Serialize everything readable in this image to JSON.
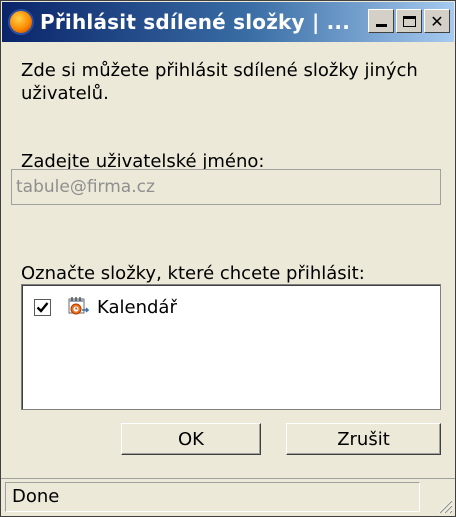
{
  "window": {
    "title": "Přihlásit sdílené složky | ..."
  },
  "dialog": {
    "intro_text": "Zde si můžete přihlásit sdílené složky jiných uživatelů.",
    "username_label": "Zadejte uživatelské jméno:",
    "username_value": "tabule@firma.cz",
    "folders_label": "Označte složky, které chcete přihlásit:",
    "folders": [
      {
        "label": "Kalendář",
        "checked": true,
        "icon": "calendar-icon"
      }
    ],
    "ok_label": "OK",
    "cancel_label": "Zrušit"
  },
  "statusbar": {
    "text": "Done"
  },
  "icons": {
    "app": "firefox-icon",
    "minimize": "minimize-icon",
    "maximize": "maximize-icon",
    "close": "close-icon"
  },
  "colors": {
    "titlebar_start": "#0a246a",
    "titlebar_end": "#a6caf0",
    "dialog_background": "#ece9d8"
  }
}
